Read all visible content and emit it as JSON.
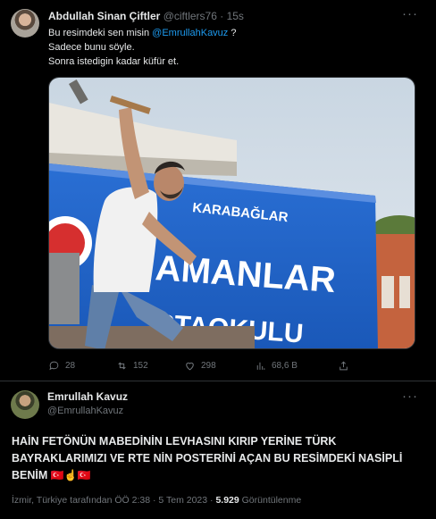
{
  "tweet1": {
    "author_name": "Abdullah Sinan Çiftler",
    "handle": "@ciftlers76",
    "separator": "·",
    "time": "15s",
    "more": "···",
    "line1_prefix": "Bu resimdeki sen misin ",
    "line1_mention": "@EmrullahKavuz",
    "line1_suffix": " ?",
    "line2": "Sadece bunu söyle.",
    "line3": "Sonra istedigin kadar küfür et.",
    "photo": {
      "sign_top": "KARABAĞLAR",
      "sign_main": "AMANLAR",
      "sign_bottom": "RTAOKULU"
    },
    "stats": {
      "replies": "28",
      "retweets": "152",
      "likes": "298",
      "views": "68,6 B"
    }
  },
  "tweet2": {
    "author_name": "Emrullah Kavuz",
    "handle": "@EmrullahKavuz",
    "more": "···",
    "text": "HAİN FETÖNÜN MABEDİNİN LEVHASINI KIRIP YERİNE TÜRK BAYRAKLARIMIZI VE RTE NİN POSTERİNİ AÇAN BU RESİMDEKİ NASİPLİ BENİM",
    "emojis": "🇹🇷☝️🇹🇷",
    "location": "İzmir, Türkiye tarafından",
    "time": "ÖÖ 2:38",
    "date": "5 Tem 2023",
    "views_count": "5.929",
    "views_label": "Görüntülenme"
  },
  "colors": {
    "background": "#000000",
    "text": "#e7e9ea",
    "muted": "#71767b",
    "link": "#1d9bf0",
    "border": "#2f3336",
    "sign_blue": "#1f63c9"
  }
}
